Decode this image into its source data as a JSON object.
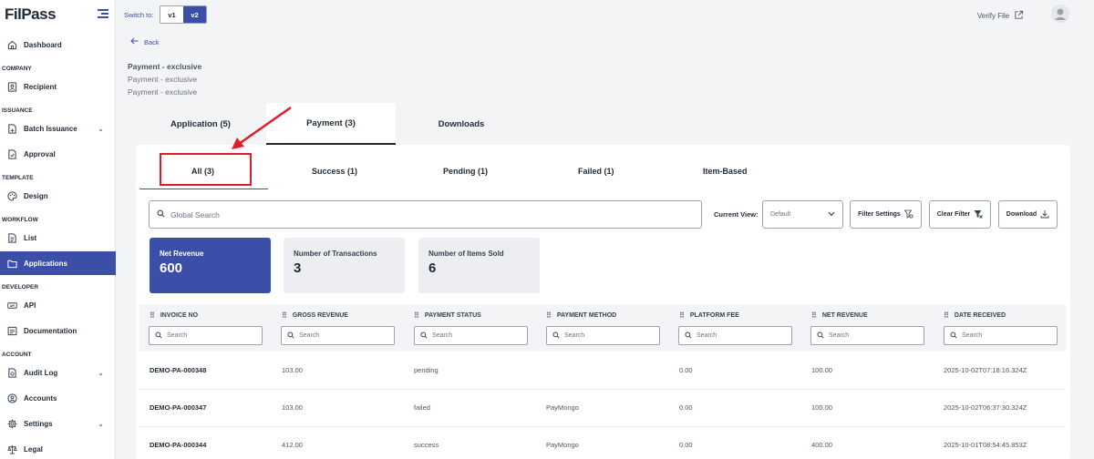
{
  "sidebar": {
    "logo": "FilPass",
    "sections": {
      "company": "COMPANY",
      "issuance": "ISSUANCE",
      "template": "TEMPLATE",
      "workflow": "WORKFLOW",
      "developer": "DEVELOPER",
      "account": "ACCOUNT"
    },
    "items": {
      "dashboard": "Dashboard",
      "recipient": "Recipient",
      "batch_issuance": "Batch Issuance",
      "approval": "Approval",
      "design": "Design",
      "list": "List",
      "applications": "Applications",
      "api": "API",
      "documentation": "Documentation",
      "audit_log": "Audit Log",
      "accounts": "Accounts",
      "settings": "Settings",
      "legal": "Legal"
    },
    "active_color": "#3b4fa8"
  },
  "topbar": {
    "switch_label": "Switch to:",
    "v1": "v1",
    "v2": "v2",
    "verify_file": "Verify File"
  },
  "page": {
    "back": "Back",
    "title": "Payment - exclusive",
    "sub1": "Payment - exclusive",
    "sub2": "Payment - exclusive"
  },
  "main_tabs": [
    "Application (5)",
    "Payment (3)",
    "Downloads"
  ],
  "sub_tabs": [
    "All (3)",
    "Success (1)",
    "Pending (1)",
    "Failed (1)",
    "Item-Based"
  ],
  "toolbar": {
    "search_placeholder": "Global Search",
    "current_view_label": "Current View:",
    "current_view_value": "Default",
    "filter_settings": "Filter Settings",
    "clear_filter": "Clear Filter",
    "download": "Download"
  },
  "stats": [
    {
      "label": "Net Revenue",
      "value": "600"
    },
    {
      "label": "Number of Transactions",
      "value": "3"
    },
    {
      "label": "Number of Items Sold",
      "value": "6"
    }
  ],
  "table": {
    "columns": [
      "INVOICE NO",
      "GROSS REVENUE",
      "PAYMENT STATUS",
      "PAYMENT METHOD",
      "PLATFORM FEE",
      "NET REVENUE",
      "DATE RECEIVED"
    ],
    "search_placeholder": "Search",
    "rows": [
      [
        "DEMO-PA-000348",
        "103.00",
        "pending",
        "",
        "0.00",
        "100.00",
        "2025-10-02T07:18:16.324Z"
      ],
      [
        "DEMO-PA-000347",
        "103.00",
        "failed",
        "PayMongo",
        "0.00",
        "100.00",
        "2025-10-02T06:37:30.324Z"
      ],
      [
        "DEMO-PA-000344",
        "412.00",
        "success",
        "PayMongo",
        "0.00",
        "400.00",
        "2025-10-01T08:54:45.853Z"
      ]
    ]
  },
  "annotation_color": "#e11d2b"
}
